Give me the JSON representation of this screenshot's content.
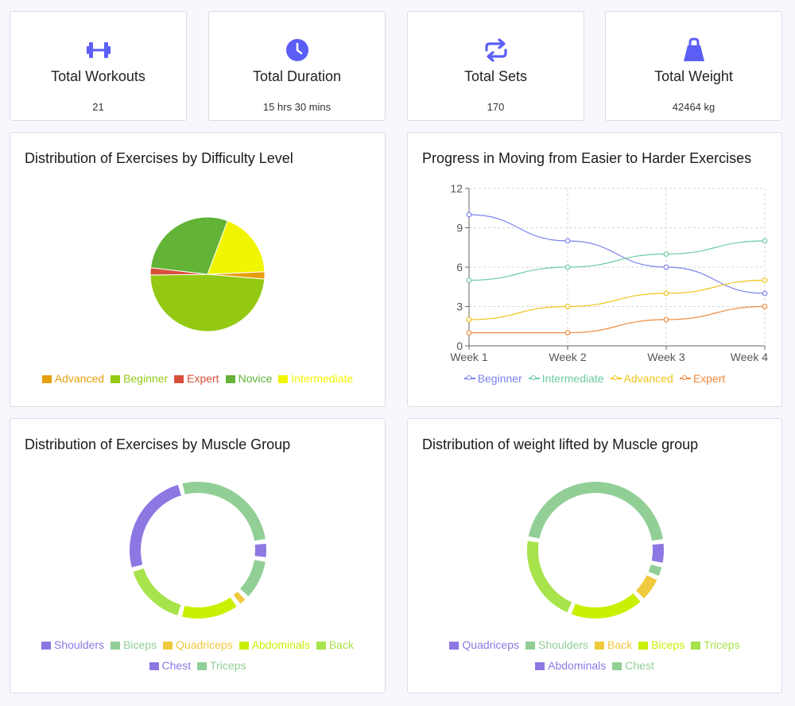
{
  "stats": [
    {
      "label": "Total Workouts",
      "value": "21",
      "icon": "dumbbell-icon"
    },
    {
      "label": "Total Duration",
      "value": "15 hrs 30 mins",
      "icon": "clock-icon"
    },
    {
      "label": "Total Sets",
      "value": "170",
      "icon": "repeat-icon"
    },
    {
      "label": "Total Weight",
      "value": "42464 kg",
      "icon": "kettlebell-icon"
    }
  ],
  "accent": "#5b5ef5",
  "panels": {
    "difficulty": {
      "title": "Distribution of Exercises by Difficulty Level"
    },
    "progress": {
      "title": "Progress in Moving from Easier to Harder Exercises"
    },
    "muscle": {
      "title": "Distribution of Exercises by Muscle Group"
    },
    "weight": {
      "title": "Distribution of weight lifted by Muscle group"
    }
  },
  "chart_data": [
    {
      "type": "pie",
      "title": "Distribution of Exercises by Difficulty Level",
      "slices": [
        {
          "name": "Advanced",
          "value": 2,
          "color": "#e5a00d"
        },
        {
          "name": "Beginner",
          "value": 47,
          "color": "#93c913"
        },
        {
          "name": "Expert",
          "value": 2,
          "color": "#d9503a"
        },
        {
          "name": "Novice",
          "value": 28,
          "color": "#62b336"
        },
        {
          "name": "Intermediate",
          "value": 18,
          "color": "#f2f500"
        }
      ],
      "legend": "bottom"
    },
    {
      "type": "line",
      "title": "Progress in Moving from Easier to Harder Exercises",
      "categories": [
        "Week 1",
        "Week 2",
        "Week 3",
        "Week 4"
      ],
      "ylim": [
        0,
        12
      ],
      "yticks": [
        0,
        3,
        6,
        9,
        12
      ],
      "grid": true,
      "legend": "bottom",
      "series": [
        {
          "name": "Beginner",
          "values": [
            10,
            8,
            6,
            4
          ],
          "color": "#7b83eb"
        },
        {
          "name": "Intermediate",
          "values": [
            5,
            6,
            7,
            8
          ],
          "color": "#6ccba0"
        },
        {
          "name": "Advanced",
          "values": [
            2,
            3,
            4,
            5
          ],
          "color": "#f0c419"
        },
        {
          "name": "Expert",
          "values": [
            1,
            1,
            2,
            3
          ],
          "color": "#ef8a3c"
        }
      ]
    },
    {
      "type": "pie",
      "subtype": "donut",
      "title": "Distribution of Exercises by Muscle Group",
      "slices": [
        {
          "name": "Shoulders",
          "value": 5,
          "color": "#8d77e2"
        },
        {
          "name": "Biceps",
          "value": 12,
          "color": "#91cf96"
        },
        {
          "name": "Quadriceps",
          "value": 3,
          "color": "#f0c93c"
        },
        {
          "name": "Abdominals",
          "value": 17,
          "color": "#c9f000"
        },
        {
          "name": "Back",
          "value": 19,
          "color": "#a7e34a"
        },
        {
          "name": "Chest",
          "value": 30,
          "color": "#8d77e2"
        },
        {
          "name": "Triceps",
          "value": 32,
          "color": "#91cf96"
        }
      ],
      "legend": "bottom"
    },
    {
      "type": "pie",
      "subtype": "donut",
      "title": "Distribution of weight lifted by Muscle group",
      "slices": [
        {
          "name": "Quadriceps",
          "value": 7,
          "color": "#8d77e2"
        },
        {
          "name": "Shoulders",
          "value": 4,
          "color": "#91cf96"
        },
        {
          "name": "Back",
          "value": 8,
          "color": "#f0c93c"
        },
        {
          "name": "Biceps",
          "value": 23,
          "color": "#c9f000"
        },
        {
          "name": "Triceps",
          "value": 27,
          "color": "#a7e34a"
        },
        {
          "name": "Abdominals",
          "value": 0,
          "color": "#8d77e2"
        },
        {
          "name": "Chest",
          "value": 57,
          "color": "#91cf96"
        }
      ],
      "legend": "bottom"
    }
  ]
}
